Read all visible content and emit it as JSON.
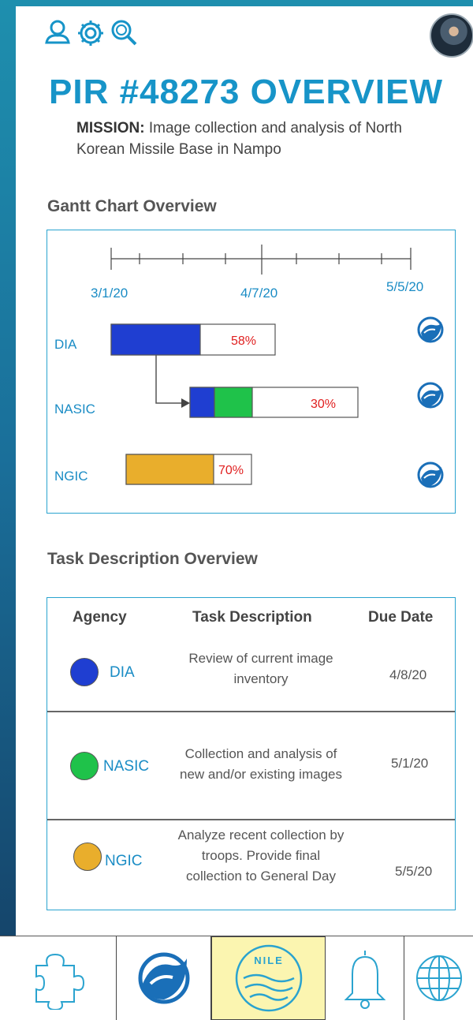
{
  "header": {
    "icons": [
      "user-icon",
      "gear-icon",
      "search-icon"
    ],
    "title": "PIR #48273 OVERVIEW",
    "mission_label": "MISSION:",
    "mission_text": "Image collection and analysis of North Korean Missile Base in Nampo"
  },
  "gantt": {
    "section_title": "Gantt Chart Overview",
    "dates": [
      "3/1/20",
      "4/7/20",
      "5/5/20"
    ],
    "rows": [
      {
        "agency": "DIA",
        "progress_label": "58%",
        "progress": 0.58,
        "status_icon": "nile-wave-icon"
      },
      {
        "agency": "NASIC",
        "progress_label": "30%",
        "progress": 0.3,
        "status_icon": "nile-wave-icon"
      },
      {
        "agency": "NGIC",
        "progress_label": "70%",
        "progress": 0.7,
        "status_icon": "nile-wave-icon"
      }
    ],
    "dependency": "DIA → NASIC",
    "colors": {
      "blue": "#1f3ed1",
      "green": "#1fc24a",
      "orange": "#e9ae2c",
      "accent": "#1794c8",
      "percent": "#e02020"
    }
  },
  "tasks": {
    "section_title": "Task Description Overview",
    "headers": {
      "agency": "Agency",
      "description": "Task Description",
      "due": "Due Date"
    },
    "rows": [
      {
        "agency": "DIA",
        "color": "#1f3ed1",
        "description": "Review of current image inventory",
        "due": "4/8/20"
      },
      {
        "agency": "NASIC",
        "color": "#1fc24a",
        "description": "Collection and analysis of new and/or existing images",
        "due": "5/1/20"
      },
      {
        "agency": "NGIC",
        "color": "#e9ae2c",
        "description": "Analyze recent collection by troops. Provide final collection to General Day",
        "due": "5/5/20"
      }
    ]
  },
  "tabbar": {
    "tabs": [
      {
        "icon": "puzzle-icon"
      },
      {
        "icon": "wave-logo-icon"
      },
      {
        "icon": "nile-logo-icon",
        "label": "NILE",
        "active": true
      },
      {
        "icon": "bell-icon"
      },
      {
        "icon": "globe-icon"
      }
    ]
  }
}
